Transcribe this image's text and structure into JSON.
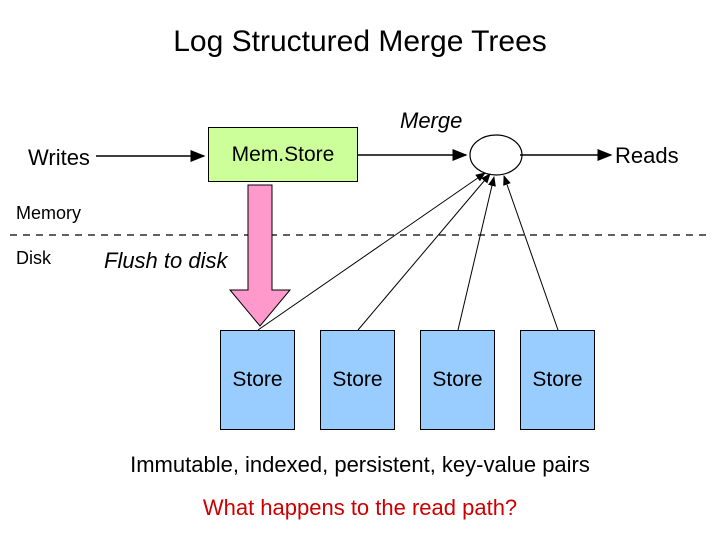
{
  "title": "Log Structured Merge Trees",
  "labels": {
    "merge": "Merge",
    "writes": "Writes",
    "reads": "Reads",
    "memstore": "Mem.Store",
    "memory": "Memory",
    "disk": "Disk",
    "flush": "Flush to disk"
  },
  "stores": [
    "Store",
    "Store",
    "Store",
    "Store"
  ],
  "caption1": "Immutable, indexed, persistent, key-value pairs",
  "caption2": "What happens to the read path?",
  "colors": {
    "memstore_bg": "#ccff99",
    "store_bg": "#99ccff",
    "flush_arrow_fill": "#ff99cc",
    "caption2_color": "#cc0000"
  }
}
